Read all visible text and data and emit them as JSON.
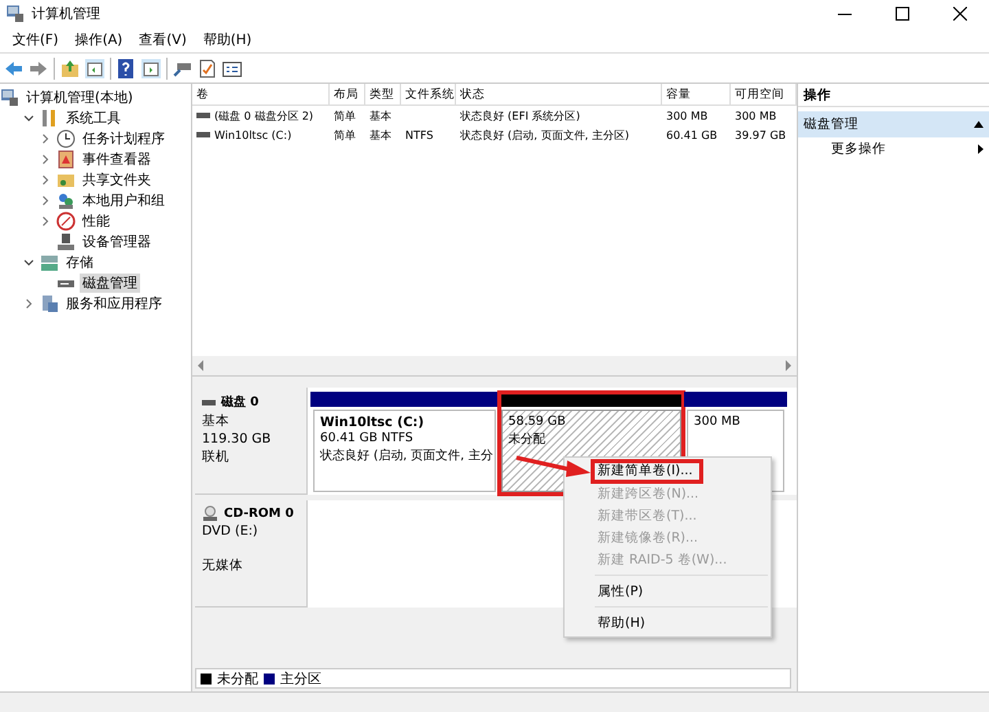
{
  "window": {
    "title": "计算机管理"
  },
  "menu": [
    "文件(F)",
    "操作(A)",
    "查看(V)",
    "帮助(H)"
  ],
  "tree": [
    {
      "label": "计算机管理(本地)",
      "selected": false,
      "children": [
        {
          "label": "系统工具",
          "expanded": true,
          "selected": false,
          "children": [
            {
              "label": "任务计划程序",
              "expanded": false,
              "selected": false
            },
            {
              "label": "事件查看器",
              "expanded": false,
              "selected": false
            },
            {
              "label": "共享文件夹",
              "expanded": false,
              "selected": false
            },
            {
              "label": "本地用户和组",
              "expanded": false,
              "selected": false
            },
            {
              "label": "性能",
              "expanded": false,
              "selected": false
            },
            {
              "label": "设备管理器",
              "selected": false
            }
          ]
        },
        {
          "label": "存储",
          "expanded": true,
          "selected": false,
          "children": [
            {
              "label": "磁盘管理",
              "selected": true
            }
          ]
        },
        {
          "label": "服务和应用程序",
          "expanded": false,
          "selected": false
        }
      ]
    }
  ],
  "table": {
    "columns": [
      "卷",
      "布局",
      "类型",
      "文件系统",
      "状态",
      "容量",
      "可用空间"
    ],
    "rows": [
      [
        "(磁盘 0 磁盘分区 2)",
        "简单",
        "基本",
        "",
        "状态良好 (EFI 系统分区)",
        "300 MB",
        "300 MB"
      ],
      [
        "Win10ltsc (C:)",
        "简单",
        "基本",
        "NTFS",
        "状态良好 (启动, 页面文件, 主分区)",
        "60.41 GB",
        "39.97 GB"
      ]
    ]
  },
  "disks": [
    {
      "kind": "disk",
      "name": "磁盘 0",
      "lines": [
        "基本",
        "119.30 GB",
        "联机"
      ],
      "partitions": [
        {
          "kind": "primary",
          "title": "Win10ltsc  (C:)",
          "lines": [
            "60.41 GB NTFS",
            "状态良好 (启动, 页面文件, 主分"
          ],
          "selected": false
        },
        {
          "kind": "unallocated",
          "lines": [
            "58.59 GB",
            "未分配"
          ],
          "selected": true,
          "highlighted": true
        },
        {
          "kind": "primary",
          "lines": [
            "300 MB"
          ],
          "selected": false
        }
      ]
    },
    {
      "kind": "cdrom",
      "name": "CD-ROM 0",
      "lines": [
        "DVD (E:)",
        "无媒体"
      ]
    }
  ],
  "legend": [
    {
      "label": "未分配",
      "color": "#000000"
    },
    {
      "label": "主分区",
      "color": "#000080"
    }
  ],
  "context_menu": [
    {
      "kind": "item",
      "label": "新建简单卷(I)...",
      "disabled": false,
      "highlighted": true
    },
    {
      "kind": "item",
      "label": "新建跨区卷(N)...",
      "disabled": true
    },
    {
      "kind": "item",
      "label": "新建带区卷(T)...",
      "disabled": true
    },
    {
      "kind": "item",
      "label": "新建镜像卷(R)...",
      "disabled": true
    },
    {
      "kind": "item",
      "label": "新建 RAID-5 卷(W)...",
      "disabled": true
    },
    {
      "kind": "separator"
    },
    {
      "kind": "item",
      "label": "属性(P)",
      "disabled": false
    },
    {
      "kind": "separator"
    },
    {
      "kind": "item",
      "label": "帮助(H)",
      "disabled": false
    }
  ],
  "actions": {
    "title": "操作",
    "section": "磁盘管理",
    "items": [
      "更多操作"
    ]
  }
}
